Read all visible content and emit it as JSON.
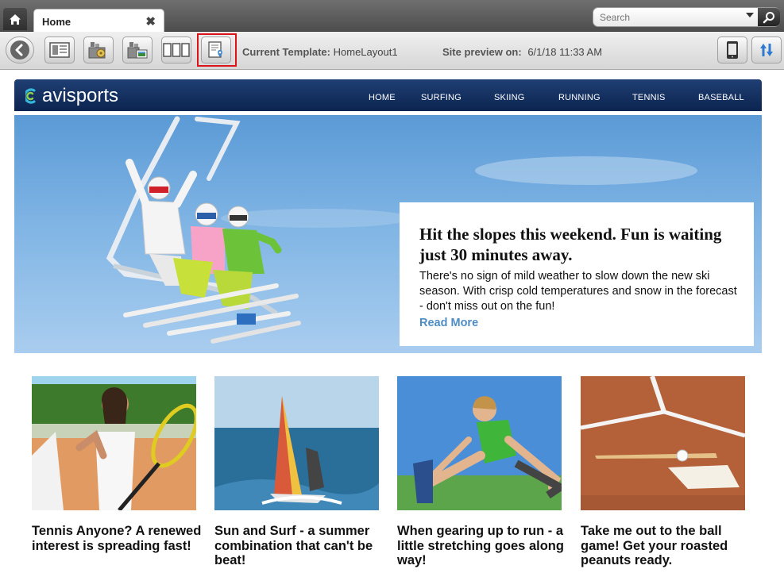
{
  "tabs": [
    {
      "label": "Home",
      "close": "✖"
    }
  ],
  "search": {
    "placeholder": "Search"
  },
  "toolbar": {
    "template_label": "Current Template:",
    "template_value": "HomeLayout1",
    "preview_label": "Site preview on:",
    "preview_value": "6/1/18 11:33 AM",
    "buttons": [
      "back-icon",
      "page-list-icon",
      "content-palette-icon",
      "image-palette-icon",
      "layout-icon",
      "page-properties-icon",
      "mobile-icon",
      "refresh-sync-icon"
    ]
  },
  "site": {
    "logo": {
      "part1": "avi",
      "part2": "sports"
    },
    "nav": [
      "HOME",
      "SURFING",
      "SKIING",
      "RUNNING",
      "TENNIS",
      "BASEBALL"
    ],
    "hero": {
      "title": "Hit the slopes this weekend. Fun is waiting just 30 minutes away.",
      "body": "There's no sign of mild weather to slow down the new ski season.  With crisp cold temperatures and snow in the forecast - don't miss out on the fun!",
      "link": "Read More"
    },
    "cards": [
      {
        "title": "Tennis Anyone? A renewed interest is spreading fast!"
      },
      {
        "title": "Sun and Surf - a summer combination that can't be beat!"
      },
      {
        "title": "When gearing up to run - a little stretching goes along way!"
      },
      {
        "title": "Take me out to the ball game! Get your roasted peanuts ready."
      }
    ]
  },
  "colors": {
    "header_navy": "#0c2450",
    "highlight_red": "#d9141b",
    "link_blue": "#4d8dc4",
    "sky": "#7fb4e4"
  }
}
